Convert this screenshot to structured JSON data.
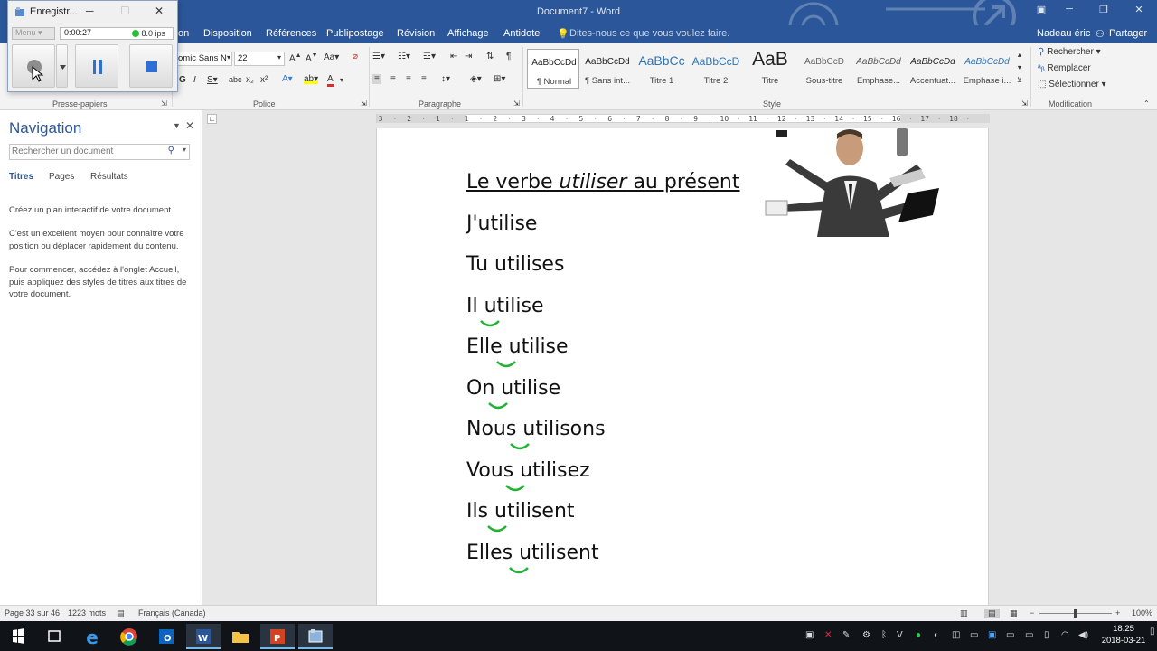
{
  "window": {
    "title": "Document7 - Word",
    "user_name": "Nadeau éric",
    "share_label": "Partager"
  },
  "tabs": {
    "partial": "on",
    "items": [
      "Disposition",
      "Références",
      "Publipostage",
      "Révision",
      "Affichage",
      "Antidote"
    ],
    "tell_me": "Dites-nous ce que vous voulez faire."
  },
  "ribbon": {
    "groups": {
      "clipboard": "Presse-papiers",
      "font": "Police",
      "paragraph": "Paragraphe",
      "style": "Style",
      "editing": "Modification"
    },
    "font_name": "omic Sans N",
    "font_size": "22",
    "styles": [
      {
        "preview": "AaBbCcDd",
        "name": "¶ Normal"
      },
      {
        "preview": "AaBbCcDd",
        "name": "¶ Sans int..."
      },
      {
        "preview": "AaBbCc",
        "name": "Titre 1"
      },
      {
        "preview": "AaBbCcD",
        "name": "Titre 2"
      },
      {
        "preview": "AaB",
        "name": "Titre"
      },
      {
        "preview": "AaBbCcD",
        "name": "Sous-titre"
      },
      {
        "preview": "AaBbCcDd",
        "name": "Emphase..."
      },
      {
        "preview": "AaBbCcDd",
        "name": "Accentuat..."
      },
      {
        "preview": "AaBbCcDd",
        "name": "Emphase i..."
      }
    ],
    "editing": {
      "find": "Rechercher",
      "replace": "Remplacer",
      "select": "Sélectionner"
    }
  },
  "navigation": {
    "title": "Navigation",
    "search_placeholder": "Rechercher un document",
    "tabs": [
      "Titres",
      "Pages",
      "Résultats"
    ],
    "paragraphs": [
      "Créez un plan interactif de votre document.",
      "C'est un excellent moyen pour connaître votre position ou déplacer rapidement du contenu.",
      "Pour commencer, accédez à l'onglet Accueil, puis appliquez des styles de titres aux titres de votre document."
    ]
  },
  "document": {
    "heading_pre": "Le verbe ",
    "heading_em": "utiliser",
    "heading_post": " au présent",
    "lines": [
      "J'utilise",
      "Tu utilises",
      "Il utilise",
      "Elle utilise",
      "On utilise",
      "Nous utilisons",
      "Vous utilisez",
      "Ils utilisent",
      "Elles utilisent"
    ]
  },
  "ruler": {
    "labels": [
      "3",
      "2",
      "1",
      "1",
      "2",
      "3",
      "4",
      "5",
      "6",
      "7",
      "8",
      "9",
      "10",
      "11",
      "12",
      "13",
      "14",
      "15",
      "16",
      "17",
      "18"
    ]
  },
  "status": {
    "page": "Page 33 sur 46",
    "words": "1223 mots",
    "language": "Français (Canada)",
    "zoom": "100%"
  },
  "recorder": {
    "title": "Enregistr...",
    "menu": "Menu",
    "time": "0:00:27",
    "fps": "8.0 ips"
  },
  "taskbar": {
    "time": "18:25",
    "date": "2018-03-21"
  },
  "colors": {
    "word_blue": "#2b579a",
    "liaison_green": "#22b035"
  }
}
